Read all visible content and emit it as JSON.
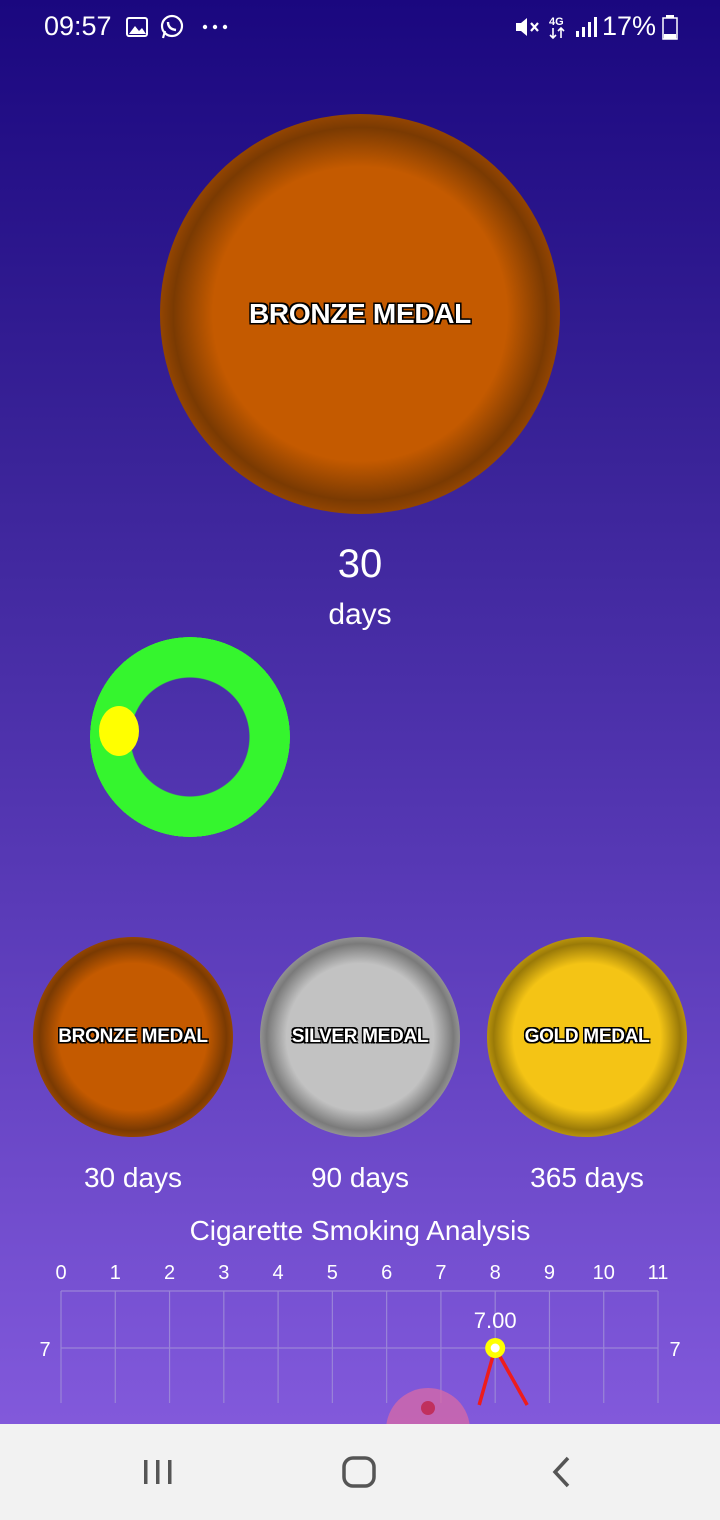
{
  "status_bar": {
    "time": "09:57",
    "battery": "17%",
    "icons": [
      "gallery-icon",
      "whatsapp-icon",
      "more-dots-icon",
      "mute-icon",
      "4g-icon",
      "signal-icon",
      "battery-icon"
    ]
  },
  "current_medal": {
    "label": "BRONZE MEDAL",
    "days_count": "30",
    "days_unit": "days",
    "color": "#c45a00"
  },
  "progress_ring": {
    "ring_color": "#35f52e",
    "indicator_color": "#ffff00"
  },
  "medals": [
    {
      "label": "BRONZE MEDAL",
      "days": "30 days",
      "color": "#c45a00"
    },
    {
      "label": "SILVER MEDAL",
      "days": "90 days",
      "color": "#c2c2c2"
    },
    {
      "label": "GOLD MEDAL",
      "days": "365 days",
      "color": "#f4c415"
    }
  ],
  "chart_data": {
    "type": "line",
    "title": "Cigarette Smoking Analysis",
    "x_ticks": [
      "0",
      "1",
      "2",
      "3",
      "4",
      "5",
      "6",
      "7",
      "8",
      "9",
      "10",
      "11"
    ],
    "y_tick_left": "7",
    "y_tick_right": "7",
    "xlim": [
      0,
      11
    ],
    "series": [
      {
        "points": [
          {
            "x": 8,
            "y": 7.0,
            "label": "7.00"
          }
        ],
        "color": "#ee1c1c"
      }
    ],
    "grid": true
  },
  "nav_bar": {
    "buttons": [
      "recent-apps",
      "home",
      "back"
    ]
  }
}
